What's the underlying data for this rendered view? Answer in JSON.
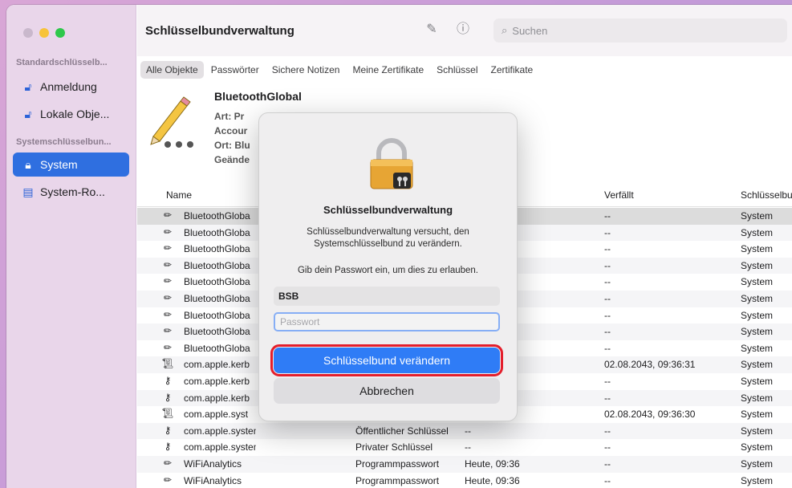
{
  "app": {
    "title": "Schlüsselbundverwaltung",
    "search_placeholder": "Suchen"
  },
  "sidebar": {
    "section_default": "Standardschlüsselb...",
    "section_system": "Systemschlüsselbun...",
    "items": [
      {
        "label": "Anmeldung",
        "icon": "lock-open-icon"
      },
      {
        "label": "Lokale Obje...",
        "icon": "lock-open-icon"
      },
      {
        "label": "System",
        "icon": "lock-icon",
        "active": true
      },
      {
        "label": "System-Ro...",
        "icon": "cabinet-icon"
      }
    ]
  },
  "tabs": [
    "Alle Objekte",
    "Passwörter",
    "Sichere Notizen",
    "Meine Zertifikate",
    "Schlüssel",
    "Zertifikate"
  ],
  "info": {
    "name": "BluetoothGlobal",
    "art": "Art: Pr",
    "account": "Accour",
    "ort": "Ort: Blu",
    "geaendert": "Geände"
  },
  "table": {
    "headers": {
      "name": "Name",
      "expires": "Verfällt",
      "keychain": "Schlüsselbu"
    },
    "rows": [
      {
        "icon": "pencil-icon",
        "name": "BluetoothGloba",
        "art": "",
        "date": "36",
        "expires": "--",
        "keychain": "System"
      },
      {
        "icon": "pencil-icon",
        "name": "BluetoothGloba",
        "art": "",
        "date": "36",
        "expires": "--",
        "keychain": "System"
      },
      {
        "icon": "pencil-icon",
        "name": "BluetoothGloba",
        "art": "",
        "date": "36",
        "expires": "--",
        "keychain": "System"
      },
      {
        "icon": "pencil-icon",
        "name": "BluetoothGloba",
        "art": "",
        "date": "36",
        "expires": "--",
        "keychain": "System"
      },
      {
        "icon": "pencil-icon",
        "name": "BluetoothGloba",
        "art": "",
        "date": "36",
        "expires": "--",
        "keychain": "System"
      },
      {
        "icon": "pencil-icon",
        "name": "BluetoothGloba",
        "art": "",
        "date": "36",
        "expires": "--",
        "keychain": "System"
      },
      {
        "icon": "pencil-icon",
        "name": "BluetoothGloba",
        "art": "",
        "date": "36",
        "expires": "--",
        "keychain": "System"
      },
      {
        "icon": "pencil-icon",
        "name": "BluetoothGloba",
        "art": "",
        "date": "36",
        "expires": "--",
        "keychain": "System"
      },
      {
        "icon": "pencil-icon",
        "name": "BluetoothGloba",
        "art": "",
        "date": "36",
        "expires": "--",
        "keychain": "System"
      },
      {
        "icon": "certificate-icon",
        "name": "com.apple.kerb",
        "art": "",
        "date": "",
        "expires": "02.08.2043, 09:36:31",
        "keychain": "System"
      },
      {
        "icon": "key-icon",
        "name": "com.apple.kerb",
        "art": "",
        "date": "",
        "expires": "--",
        "keychain": "System"
      },
      {
        "icon": "key-icon",
        "name": "com.apple.kerb",
        "art": "",
        "date": "",
        "expires": "--",
        "keychain": "System"
      },
      {
        "icon": "certificate-icon",
        "name": "com.apple.syst",
        "art": "",
        "date": "",
        "expires": "02.08.2043, 09:36:30",
        "keychain": "System"
      },
      {
        "icon": "key-icon",
        "name": "com.apple.systemdefault",
        "art": "Öffentlicher Schlüssel",
        "date": "--",
        "expires": "--",
        "keychain": "System"
      },
      {
        "icon": "key-icon",
        "name": "com.apple.systemdefault",
        "art": "Privater Schlüssel",
        "date": "--",
        "expires": "--",
        "keychain": "System"
      },
      {
        "icon": "pencil-icon",
        "name": "WiFiAnalytics",
        "art": "Programmpasswort",
        "date": "Heute, 09:36",
        "expires": "--",
        "keychain": "System"
      },
      {
        "icon": "pencil-icon",
        "name": "WiFiAnalytics",
        "art": "Programmpasswort",
        "date": "Heute, 09:36",
        "expires": "--",
        "keychain": "System"
      }
    ]
  },
  "dialog": {
    "title": "Schlüsselbundverwaltung",
    "message": "Schlüsselbundverwaltung versucht, den Systemschlüsselbund zu verändern.",
    "prompt": "Gib dein Passwort ein, um dies zu erlauben.",
    "username": "BSB",
    "password_placeholder": "Passwort",
    "primary_button": "Schlüsselbund verändern",
    "cancel_button": "Abbrechen"
  },
  "colors": {
    "accent": "#2f7cf6",
    "highlight_box": "#e41e2b",
    "sidebar_bg": "#e9d6ea"
  }
}
